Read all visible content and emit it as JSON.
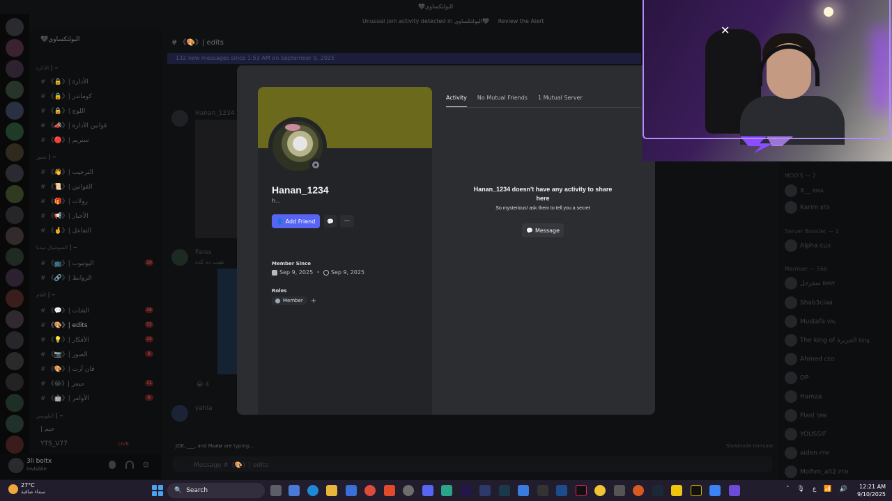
{
  "background": {
    "top_title": "🖤البولتكساوي",
    "alert_text": "Unusual join activity detected in البولتكساوي🖤",
    "alert_action": "Review the Alert",
    "guild_name": "🖤البولتكساوي",
    "channel_header": "# 《🎨》| edits",
    "new_messages_bar": "132 new messages since 1:53 AM on September 9, 2025",
    "categories": [
      "الادارة ┃ ━",
      "منتور ┃ ━",
      "السوشيال ميديا ┃ ━",
      "العام ┃ ━",
      "البلوبيس ┃ ━"
    ],
    "channels": [
      {
        "label": "《🔒》| الأدارة",
        "badge": ""
      },
      {
        "label": "《🔒》| كوماندر",
        "badge": ""
      },
      {
        "label": "《🔒》| اللوج",
        "badge": ""
      },
      {
        "label": "《📣》| قوانين الأدارة",
        "badge": ""
      },
      {
        "label": "《🔴》| ستريم",
        "badge": ""
      },
      {
        "label": "《👋》| الترحيب",
        "badge": ""
      },
      {
        "label": "《📜》| القوانين",
        "badge": ""
      },
      {
        "label": "《🎁》| رولات",
        "badge": ""
      },
      {
        "label": "《📢》| الأخبار",
        "badge": ""
      },
      {
        "label": "《🤞》| التفاعل",
        "badge": ""
      },
      {
        "label": "《📺》| اليوتيوب",
        "badge": "10"
      },
      {
        "label": "《🔗》| الروابط",
        "badge": ""
      },
      {
        "label": "《💬》| الشات",
        "badge": "16"
      },
      {
        "label": "《🎨》| edits",
        "badge": "55"
      },
      {
        "label": "《💡》| الأفكار",
        "badge": "24"
      },
      {
        "label": "《📷》| الصور",
        "badge": "8"
      },
      {
        "label": "《🎨》| فان آرت",
        "badge": ""
      },
      {
        "label": "《😂》| ميمز",
        "badge": "11"
      },
      {
        "label": "《🤖》| الأوامر",
        "badge": "8"
      }
    ],
    "voice_channel": "| جيم",
    "stream_user": "YTS_V77",
    "live_badge": "LIVE",
    "current_user": "3li boltx",
    "current_user_status": "Invisible",
    "chat_user_1": "Hanan_1234",
    "chat_user_2": "Fares",
    "chat_user_2_msg": "نفيت ده كده",
    "chat_user_3": "yahia",
    "reaction_count": "4",
    "typing": "JOE, ___, and M𝒐𝒎𝒛 are typing...",
    "slowmode": "Slowmode Immune",
    "composer_placeholder": "Message #《🎨》| edits",
    "members_header_1": "MOD'S — 2",
    "members_header_2": "Server Booster — 1",
    "members_header_3": "Member — 566",
    "members": [
      {
        "name": "X__",
        "tag": "RMA"
      },
      {
        "name": "Karim",
        "tag": "BTX"
      },
      {
        "name": "Alpha",
        "tag": "CLIX"
      },
      {
        "name": "سفرجل",
        "tag": "BMW"
      },
      {
        "name": "Shab3ciaa",
        "tag": ""
      },
      {
        "name": "Mustafa",
        "tag": "VAL"
      },
      {
        "name": "The king of الجزيرة",
        "tag": "King"
      },
      {
        "name": "Ahmed",
        "tag": "CEO"
      },
      {
        "name": "OP",
        "tag": ""
      },
      {
        "name": "Hamza",
        "tag": ""
      },
      {
        "name": "Pixel",
        "tag": "SMK"
      },
      {
        "name": "YOUSSIF",
        "tag": ""
      },
      {
        "name": "aiden",
        "tag": "FTM"
      },
      {
        "name": "Molhm_alt2",
        "tag": "PTM"
      }
    ]
  },
  "profile": {
    "username": "Hanan_1234",
    "subname": "h...",
    "add_friend_label": "Add Friend",
    "member_since_label": "Member Since",
    "discord_since": "Sep 9, 2025",
    "server_since": "Sep 9, 2025",
    "roles_label": "Roles",
    "role_name": "Member",
    "role_add": "+",
    "tabs": [
      "Activity",
      "No Mutual Friends",
      "1 Mutual Server"
    ],
    "empty_title": "Hanan_1234 doesn't have any activity to share here",
    "empty_sub": "So mysterious! ask them to tell you a secret",
    "empty_message_label": "Message",
    "banner_color": "#6b6a1c",
    "accent_color": "#5865f2"
  },
  "taskbar": {
    "weather_temp": "27°C",
    "weather_desc": "سماء صافية",
    "search_label": "Search",
    "tray_lang": "ع",
    "time": "12:21 AM",
    "date": "9/10/2025"
  }
}
